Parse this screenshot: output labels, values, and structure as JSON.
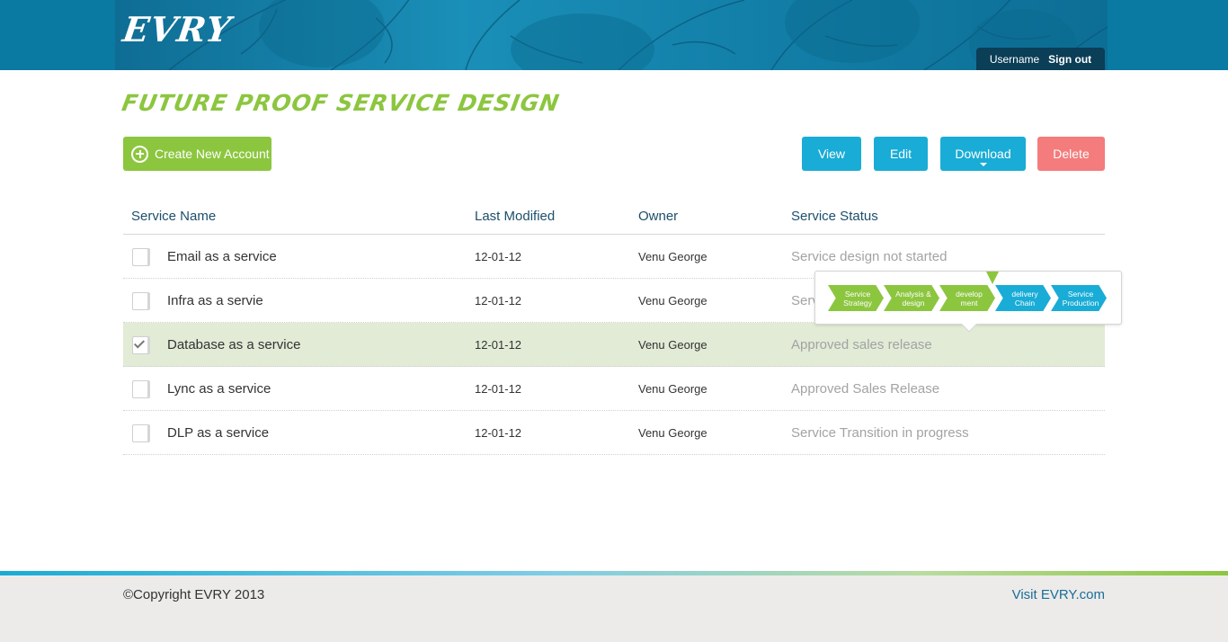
{
  "header": {
    "logo": "EVRY",
    "username": "Username",
    "signout": "Sign out"
  },
  "page": {
    "title": "FUTURE PROOF SERVICE DESIGN"
  },
  "toolbar": {
    "create_label": "Create New Account",
    "view_label": "View",
    "edit_label": "Edit",
    "download_label": "Download",
    "delete_label": "Delete"
  },
  "table": {
    "columns": [
      "Service Name",
      "Last Modified",
      "Owner",
      "Service Status"
    ],
    "rows": [
      {
        "name": "Email as a service",
        "date": "12-01-12",
        "owner": "Venu George",
        "status": "Service design not started",
        "checked": false
      },
      {
        "name": "Infra as a servie",
        "date": "12-01-12",
        "owner": "Venu George",
        "status": "Serv",
        "checked": false
      },
      {
        "name": "Database as a service",
        "date": "12-01-12",
        "owner": "Venu George",
        "status": "Approved sales release",
        "checked": true
      },
      {
        "name": "Lync as a service",
        "date": "12-01-12",
        "owner": "Venu George",
        "status": "Approved Sales Release",
        "checked": false
      },
      {
        "name": "DLP as a service",
        "date": "12-01-12",
        "owner": "Venu George",
        "status": "Service Transition in progress",
        "checked": false
      }
    ]
  },
  "tooltip": {
    "stages": [
      {
        "label": "Service Strategy",
        "color": "#8cc63f"
      },
      {
        "label": "Analysis & design",
        "color": "#8cc63f"
      },
      {
        "label": "develop ment",
        "color": "#8cc63f"
      },
      {
        "label": "delivery Chain",
        "color": "#19acd6"
      },
      {
        "label": "Service Production",
        "color": "#19acd6"
      }
    ]
  },
  "footer": {
    "copyright": "©Copyright EVRY 2013",
    "visit": "Visit EVRY.com"
  },
  "colors": {
    "accent_green": "#8cc63f",
    "accent_blue": "#19acd6",
    "delete_red": "#f47c7c",
    "header_blue": "#0a7aa3"
  }
}
